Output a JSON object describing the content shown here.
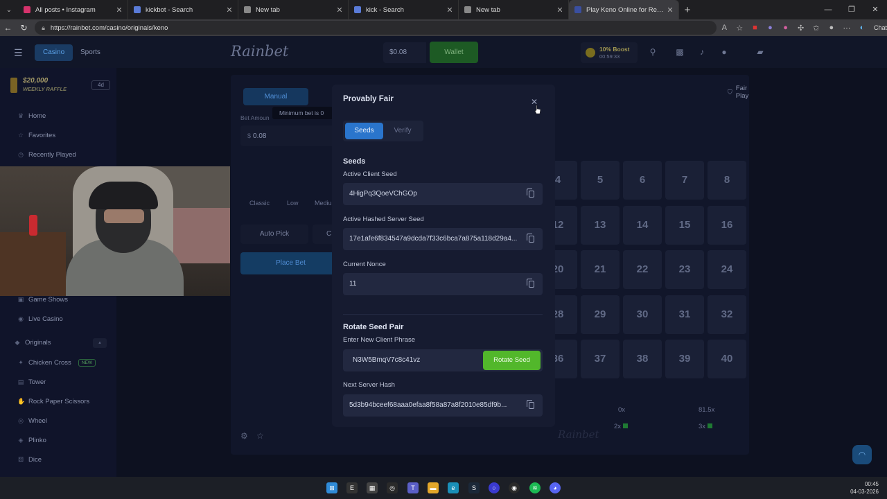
{
  "browser": {
    "tabs": [
      {
        "label": "All posts • Instagram",
        "color": "#d6336c"
      },
      {
        "label": "kickbot - Search",
        "color": "#5a7bd8"
      },
      {
        "label": "New tab",
        "color": "#888888"
      },
      {
        "label": "kick - Search",
        "color": "#5a7bd8"
      },
      {
        "label": "New tab",
        "color": "#888888"
      },
      {
        "label": "Play Keno Online for Real Money",
        "color": "#3a4fa0"
      }
    ],
    "url": "https://rainbet.com/casino/originals/keno",
    "copilot_label": "Chat"
  },
  "site": {
    "nav": {
      "casino": "Casino",
      "sports": "Sports",
      "logo": "Rainbet",
      "balance": "$0.08",
      "wallet": "Wallet",
      "boost_title": "10% Boost",
      "boost_timer": "00:59:33"
    },
    "sidebar": {
      "raffle_amount": "$20,000",
      "raffle_label": "WEEKLY RAFFLE",
      "raffle_badge": "4d",
      "items": [
        {
          "label": "Home",
          "icon": "♛"
        },
        {
          "label": "Favorites",
          "icon": "☆"
        },
        {
          "label": "Recently Played",
          "icon": "◷"
        },
        {
          "label": "Game Shows",
          "icon": "▣"
        },
        {
          "label": "Live Casino",
          "icon": "◉"
        },
        {
          "label": "Originals",
          "icon": "◆"
        },
        {
          "label": "Chicken Cross",
          "icon": "✦",
          "badge": "NEW"
        },
        {
          "label": "Tower",
          "icon": "▤"
        },
        {
          "label": "Rock Paper Scissors",
          "icon": "✋"
        },
        {
          "label": "Wheel",
          "icon": "◎"
        },
        {
          "label": "Plinko",
          "icon": "◈"
        },
        {
          "label": "Dice",
          "icon": "⚄"
        }
      ]
    },
    "game": {
      "manual": "Manual",
      "bet_amount_label": "Bet Amoun",
      "tooltip": "Minimum bet is 0",
      "bet_value": "0.08",
      "currency": "$",
      "risk": [
        "Classic",
        "Low",
        "Mediu"
      ],
      "auto_pick": "Auto Pick",
      "clear": "C",
      "place_bet": "Place Bet",
      "fair_play": "Fair Play",
      "tiles": [
        [
          "4",
          "5",
          "6",
          "7",
          "8"
        ],
        [
          "12",
          "13",
          "14",
          "15",
          "16"
        ],
        [
          "20",
          "21",
          "22",
          "23",
          "24"
        ],
        [
          "28",
          "29",
          "30",
          "31",
          "32"
        ],
        [
          "36",
          "37",
          "38",
          "39",
          "40"
        ]
      ],
      "payouts": [
        "0x",
        "81.5x",
        "2x",
        "3x"
      ],
      "footer_logo": "Rainbet"
    },
    "modal": {
      "title": "Provably Fair",
      "tab_seeds": "Seeds",
      "tab_verify": "Verify",
      "section_seeds": "Seeds",
      "active_client_seed_label": "Active Client Seed",
      "active_client_seed": "4HigPq3QoeVChGOp",
      "active_hashed_server_seed_label": "Active Hashed Server Seed",
      "active_hashed_server_seed": "17e1afe6f834547a9dcda7f33c6bca7a875a118d29a4...",
      "current_nonce_label": "Current Nonce",
      "current_nonce": "11",
      "rotate_section": "Rotate Seed Pair",
      "new_client_phrase_label": "Enter New Client Phrase",
      "new_client_phrase": "N3W5BmqV7c8c41vz",
      "rotate_button": "Rotate Seed",
      "next_server_hash_label": "Next Server Hash",
      "next_server_hash": "5d3b94bceef68aaa0efaa8f58a87a8f2010e85df9b..."
    }
  },
  "taskbar": {
    "time": "00:45",
    "date": "04-03-2026"
  }
}
